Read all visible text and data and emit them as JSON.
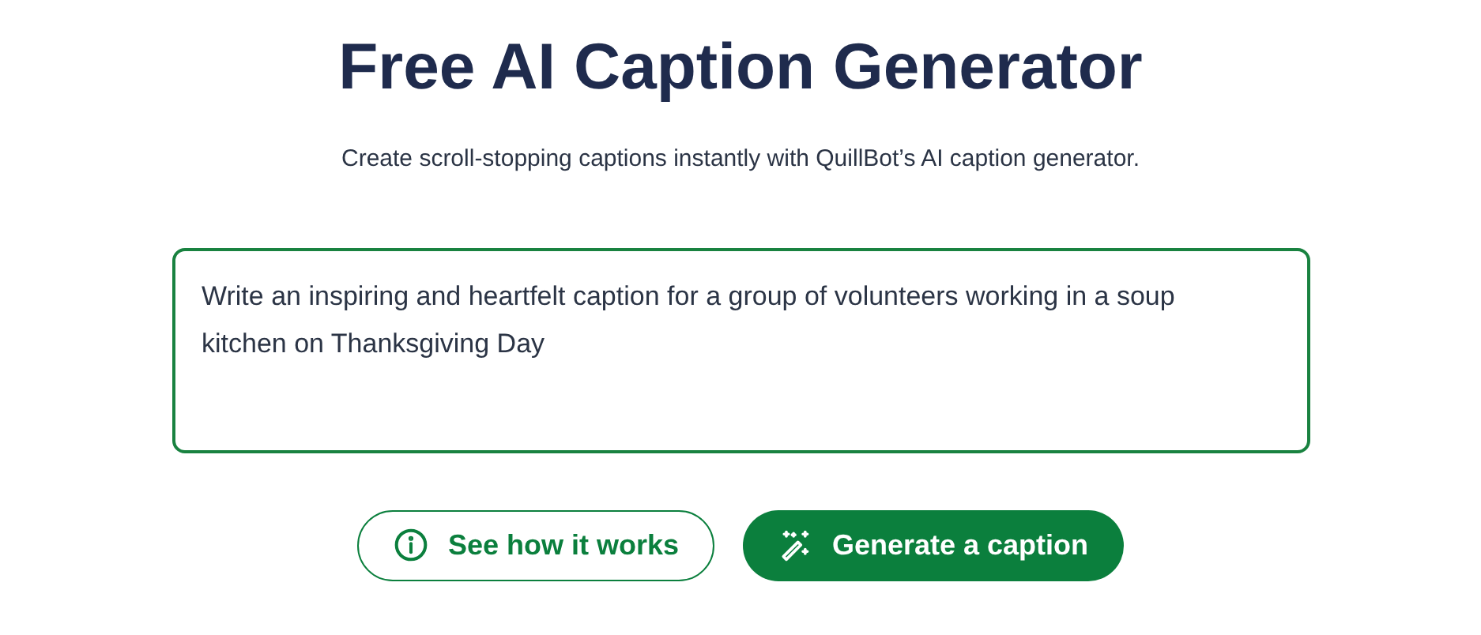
{
  "title": "Free AI Caption Generator",
  "subtitle": "Create scroll-stopping captions instantly with QuillBot’s AI caption generator.",
  "prompt": {
    "value": "Write an inspiring and heartfelt caption for a group of volunteers working in a soup kitchen on Thanksgiving Day"
  },
  "buttons": [
    {
      "label": "See how it works",
      "kind": "outline"
    },
    {
      "label": "Generate a caption",
      "kind": "primary"
    }
  ]
}
